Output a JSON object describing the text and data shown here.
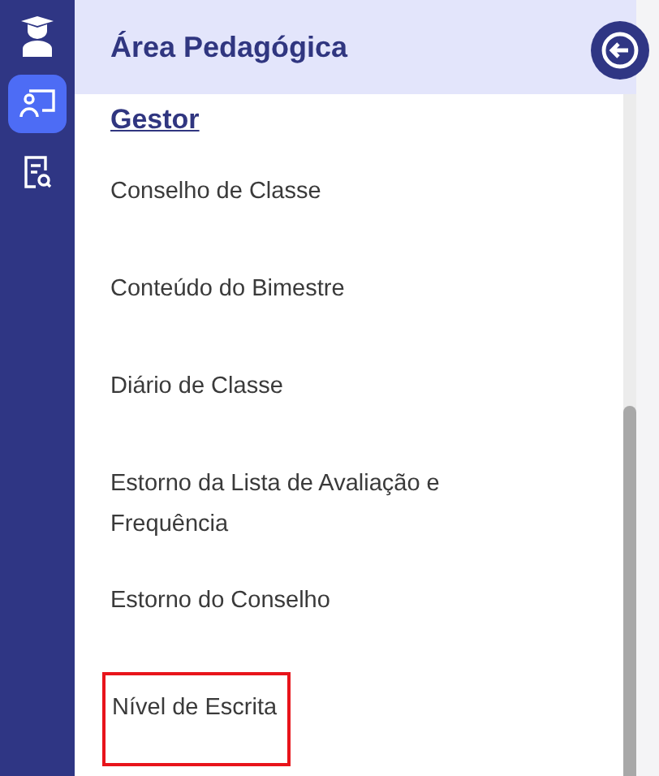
{
  "rail": {
    "items": [
      {
        "kind": "graduate",
        "selected": false
      },
      {
        "kind": "classroom",
        "selected": true
      },
      {
        "kind": "report",
        "selected": false
      }
    ]
  },
  "panel": {
    "title": "Área Pedagógica",
    "section": "Gestor",
    "items": [
      {
        "label": "Conselho de Classe",
        "highlighted": false
      },
      {
        "label": "Conteúdo do Bimestre",
        "highlighted": false
      },
      {
        "label": "Diário de Classe",
        "highlighted": false
      },
      {
        "label": "Estorno da Lista de Avaliação e Frequência",
        "highlighted": false
      },
      {
        "label": "Estorno do Conselho",
        "highlighted": false
      },
      {
        "label": "Nível de Escrita",
        "highlighted": true
      }
    ]
  }
}
